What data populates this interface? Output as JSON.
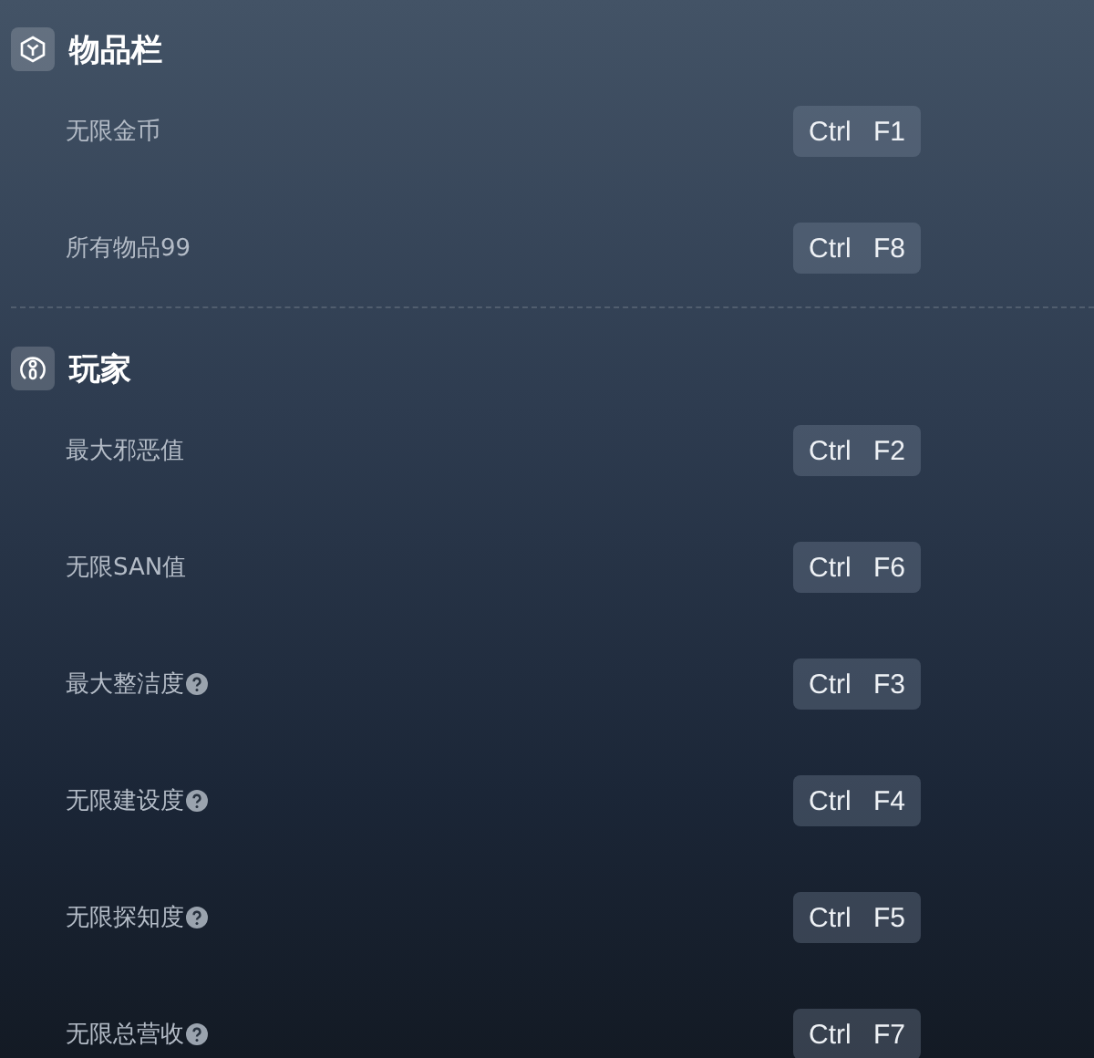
{
  "sections": [
    {
      "title": "物品栏",
      "kind": "box",
      "rows": [
        {
          "label": "无限金币",
          "hint": false,
          "hotkey": "Ctrl F1"
        },
        {
          "label": "所有物品99",
          "hint": false,
          "hotkey": "Ctrl F8"
        }
      ]
    },
    {
      "title": "玩家",
      "kind": "person",
      "rows": [
        {
          "label": "最大邪恶值",
          "hint": false,
          "hotkey": "Ctrl F2"
        },
        {
          "label": "无限SAN值",
          "hint": false,
          "hotkey": "Ctrl F6"
        },
        {
          "label": "最大整洁度",
          "hint": true,
          "hotkey": "Ctrl F3"
        },
        {
          "label": "无限建设度",
          "hint": true,
          "hotkey": "Ctrl F4"
        },
        {
          "label": "无限探知度",
          "hint": true,
          "hotkey": "Ctrl F5"
        },
        {
          "label": "无限总营收",
          "hint": true,
          "hotkey": "Ctrl F7"
        }
      ]
    }
  ]
}
